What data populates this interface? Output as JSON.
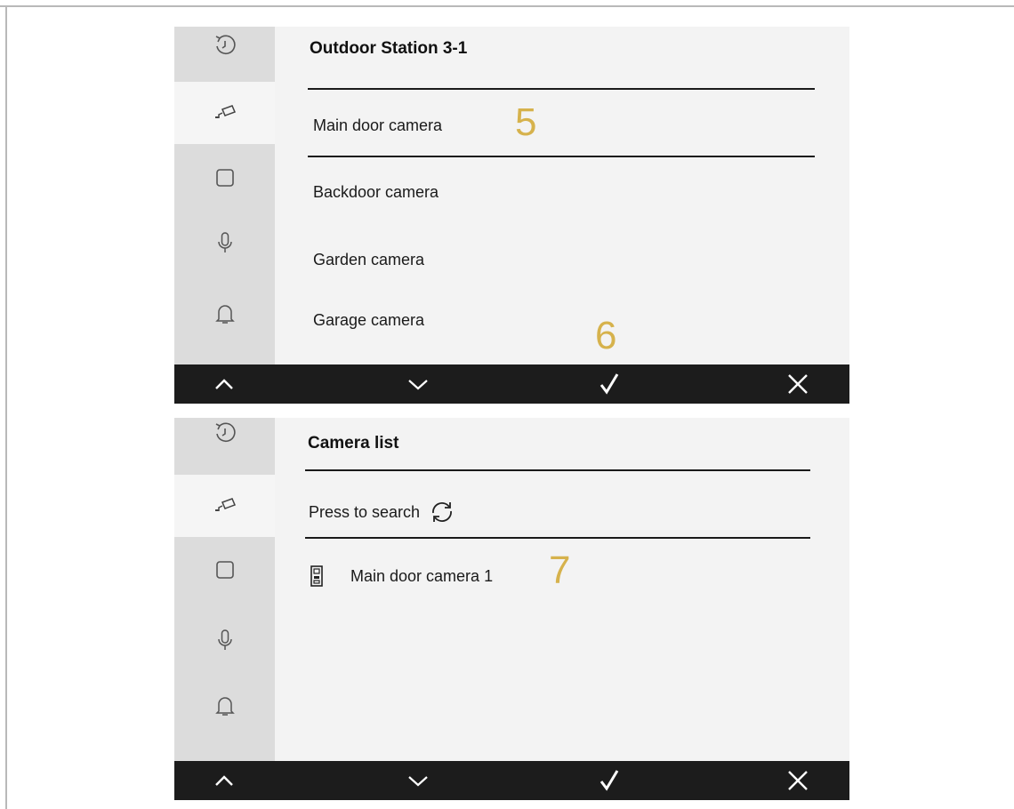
{
  "screen_top": {
    "title": "Outdoor Station 3-1",
    "items": [
      "Main door camera",
      "Backdoor camera",
      "Garden camera",
      "Garage camera"
    ],
    "annotations": [
      "5",
      "6"
    ]
  },
  "screen_bottom": {
    "title": "Camera list",
    "search_label": "Press to search",
    "items": [
      "Main door camera 1"
    ],
    "annotations": [
      "7"
    ]
  },
  "sidebar_icons": [
    "history-icon",
    "camera-icon",
    "square-icon",
    "microphone-icon",
    "bell-icon"
  ],
  "bottom_bar_icons": [
    "chevron-up-icon",
    "chevron-down-icon",
    "check-icon",
    "close-icon"
  ],
  "colors": {
    "annotation": "#d6b24c",
    "bottom_bar": "#1c1c1c",
    "sidebar": "#dcdcdc",
    "content": "#f3f3f3"
  }
}
